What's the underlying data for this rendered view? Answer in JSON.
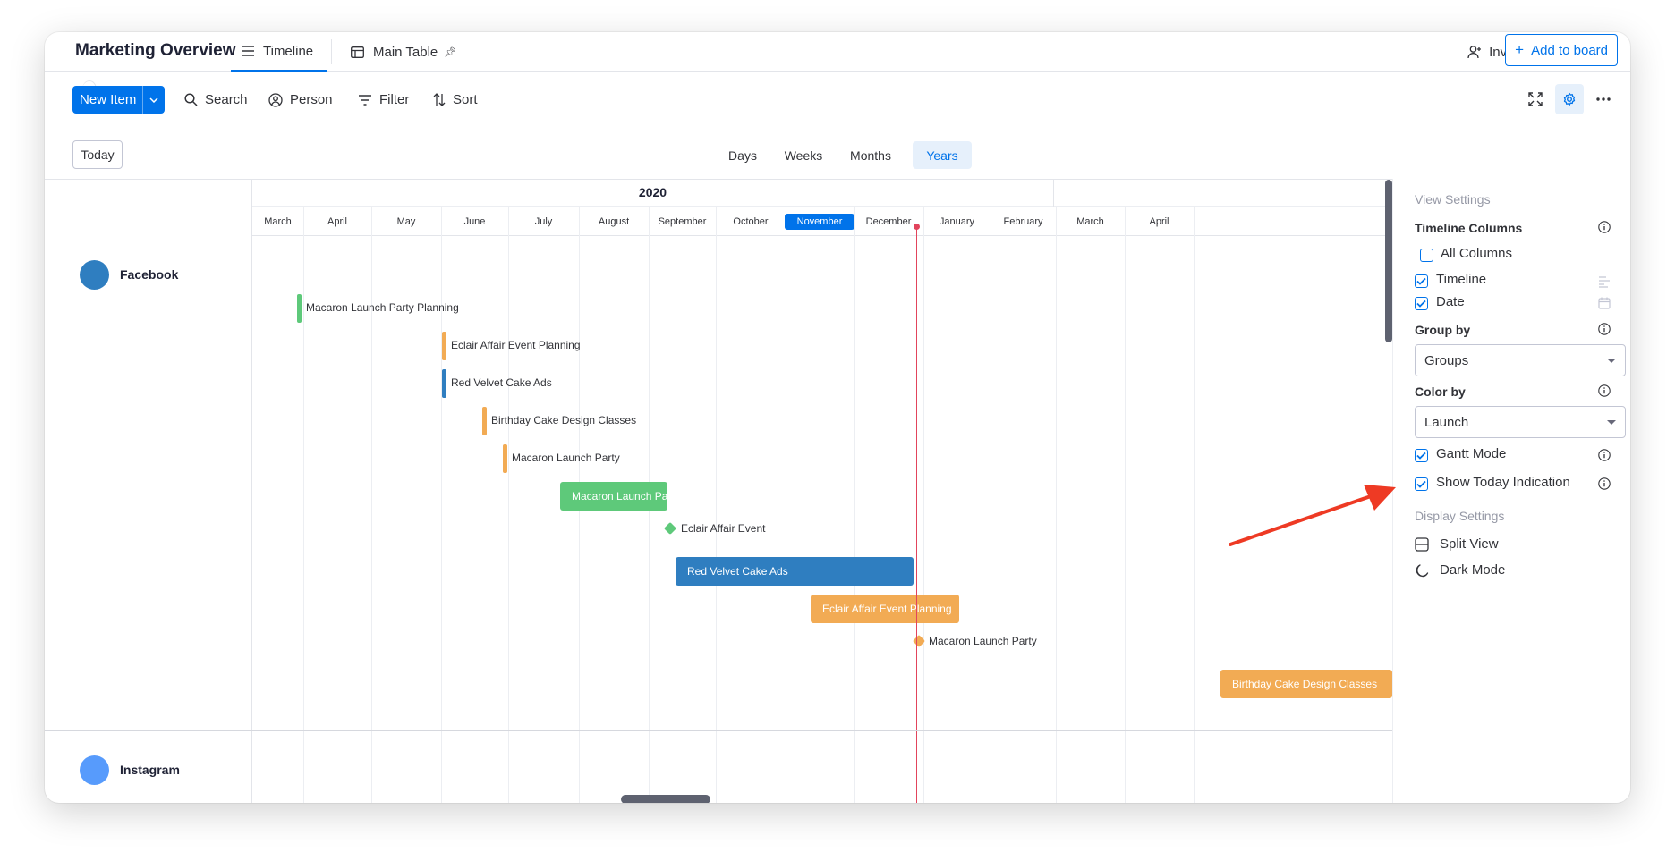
{
  "header": {
    "board_title": "Marketing Overview",
    "tabs": [
      {
        "label": "Timeline",
        "active": true
      },
      {
        "label": "Main Table",
        "pinned": true
      }
    ],
    "invite_label": "Invite",
    "add_to_board_label": "Add to board"
  },
  "toolbar": {
    "new_item_label": "New Item",
    "search_label": "Search",
    "person_label": "Person",
    "filter_label": "Filter",
    "sort_label": "Sort"
  },
  "scale": {
    "today_label": "Today",
    "options": [
      "Days",
      "Weeks",
      "Months",
      "Years"
    ],
    "selected": "Years"
  },
  "timeline": {
    "year_label": "2020",
    "months": [
      "March",
      "April",
      "May",
      "June",
      "July",
      "August",
      "September",
      "October",
      "November",
      "December",
      "January",
      "February",
      "March",
      "April"
    ],
    "active_month": "November",
    "groups": [
      {
        "name": "Facebook",
        "color": "#2f7ec0"
      },
      {
        "name": "Instagram",
        "color": "#579bfc"
      }
    ],
    "tasks": [
      {
        "label": "Macaron Launch Party Planning",
        "kind": "marker",
        "color": "#5ec97a"
      },
      {
        "label": "Eclair Affair Event Planning",
        "kind": "marker",
        "color": "#f2ab54"
      },
      {
        "label": "Red Velvet Cake Ads",
        "kind": "marker",
        "color": "#2f7ec0"
      },
      {
        "label": "Birthday Cake Design Classes",
        "kind": "marker",
        "color": "#f2ab54"
      },
      {
        "label": "Macaron Launch Party",
        "kind": "marker",
        "color": "#f2ab54"
      },
      {
        "label": "Macaron Launch Pa",
        "kind": "bar",
        "color": "#5ec97a"
      },
      {
        "label": "Eclair Affair Event",
        "kind": "milestone",
        "color": "#5ec97a"
      },
      {
        "label": "Red Velvet Cake Ads",
        "kind": "bar",
        "color": "#2f7ec0"
      },
      {
        "label": "Eclair Affair Event Planning",
        "kind": "bar",
        "color": "#f2ab54"
      },
      {
        "label": "Macaron Launch Party",
        "kind": "milestone",
        "color": "#f2ab54"
      },
      {
        "label": "Birthday Cake Design Classes",
        "kind": "bar",
        "color": "#f2ab54"
      }
    ]
  },
  "view_settings": {
    "section_title": "View Settings",
    "timeline_columns_label": "Timeline Columns",
    "all_columns_label": "All Columns",
    "all_columns_checked": false,
    "timeline_col_label": "Timeline",
    "timeline_col_checked": true,
    "date_col_label": "Date",
    "date_col_checked": true,
    "group_by_label": "Group by",
    "group_by_value": "Groups",
    "color_by_label": "Color by",
    "color_by_value": "Launch",
    "gantt_mode_label": "Gantt Mode",
    "gantt_mode_checked": true,
    "show_today_label": "Show Today Indication",
    "show_today_checked": true
  },
  "display_settings": {
    "section_title": "Display Settings",
    "split_view_label": "Split View",
    "dark_mode_label": "Dark Mode"
  },
  "colors": {
    "primary": "#0073ea",
    "today_line": "#e2445c",
    "annotation_arrow": "#ee3a24"
  }
}
